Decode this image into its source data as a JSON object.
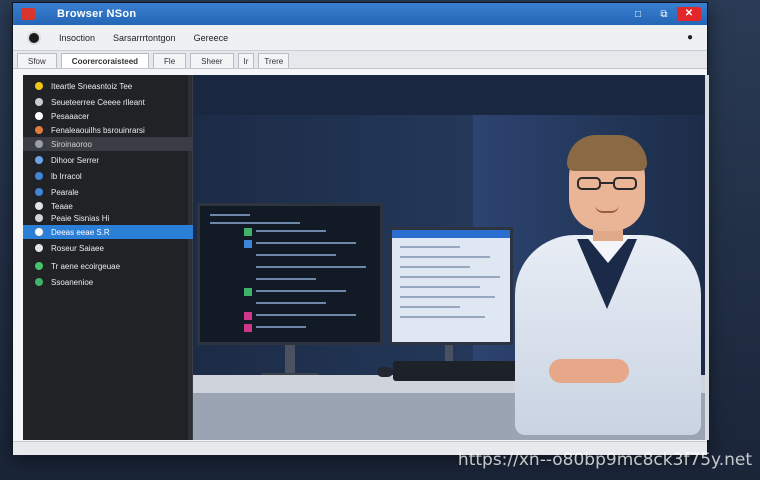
{
  "window": {
    "title": "Browser NSon",
    "controls": {
      "minimize": "□",
      "restore": "⧉",
      "close": "✕"
    }
  },
  "toolbar": {
    "items": [
      "Insoction",
      "Sarsarrrtontgon",
      "Gereece"
    ],
    "menu_dot": "●"
  },
  "tabs": [
    {
      "label": "Sfow",
      "active": false
    },
    {
      "label": "Coorercoraisteed",
      "active": true
    },
    {
      "label": "Fle",
      "active": false
    },
    {
      "label": "Sheer",
      "active": false
    },
    {
      "label": "Ir",
      "active": false
    },
    {
      "label": "Trere",
      "active": false
    }
  ],
  "sidebar": {
    "items": [
      {
        "label": "Iteartle Sneasntoiz Tee",
        "type": "item",
        "icon_color": "#f0c419"
      },
      {
        "label": "Seueteerree Ceeee rlleant",
        "type": "item",
        "icon_color": "#c7ccd3"
      },
      {
        "label": "Pesaaacer",
        "type": "item",
        "icon_color": "#ffffff"
      },
      {
        "label": "Fenaleaouilhs bsrouinrarsi",
        "type": "item",
        "icon_color": "#e07b39"
      },
      {
        "label": "Siroinaoroo",
        "type": "section",
        "icon_color": "#9aa0a8"
      },
      {
        "label": "Dihoor Serrer",
        "type": "item",
        "icon_color": "#6aa3e6"
      },
      {
        "label": "lb Irracol",
        "type": "item",
        "icon_color": "#3f86d8"
      },
      {
        "label": "Pearale",
        "type": "item",
        "icon_color": "#3f86d8"
      },
      {
        "label": "Teaae",
        "type": "item",
        "icon_color": "#e0e3e7"
      },
      {
        "label": "Peaie Sisnias Hi",
        "type": "item",
        "icon_color": "#d0d4da"
      },
      {
        "label": "Deeas eeae S.R",
        "type": "selected",
        "icon_color": "#ffffff"
      },
      {
        "label": "Roseur Saiaee",
        "type": "item",
        "icon_color": "#e0e3e7"
      },
      {
        "label": "Tr aene ecoirgeuae",
        "type": "item",
        "icon_color": "#45c46a"
      },
      {
        "label": "Ssoanenioe",
        "type": "item",
        "icon_color": "#3fb36a"
      }
    ]
  },
  "watermark": "https://xn--o80bp9mc8ck3f75y.net"
}
